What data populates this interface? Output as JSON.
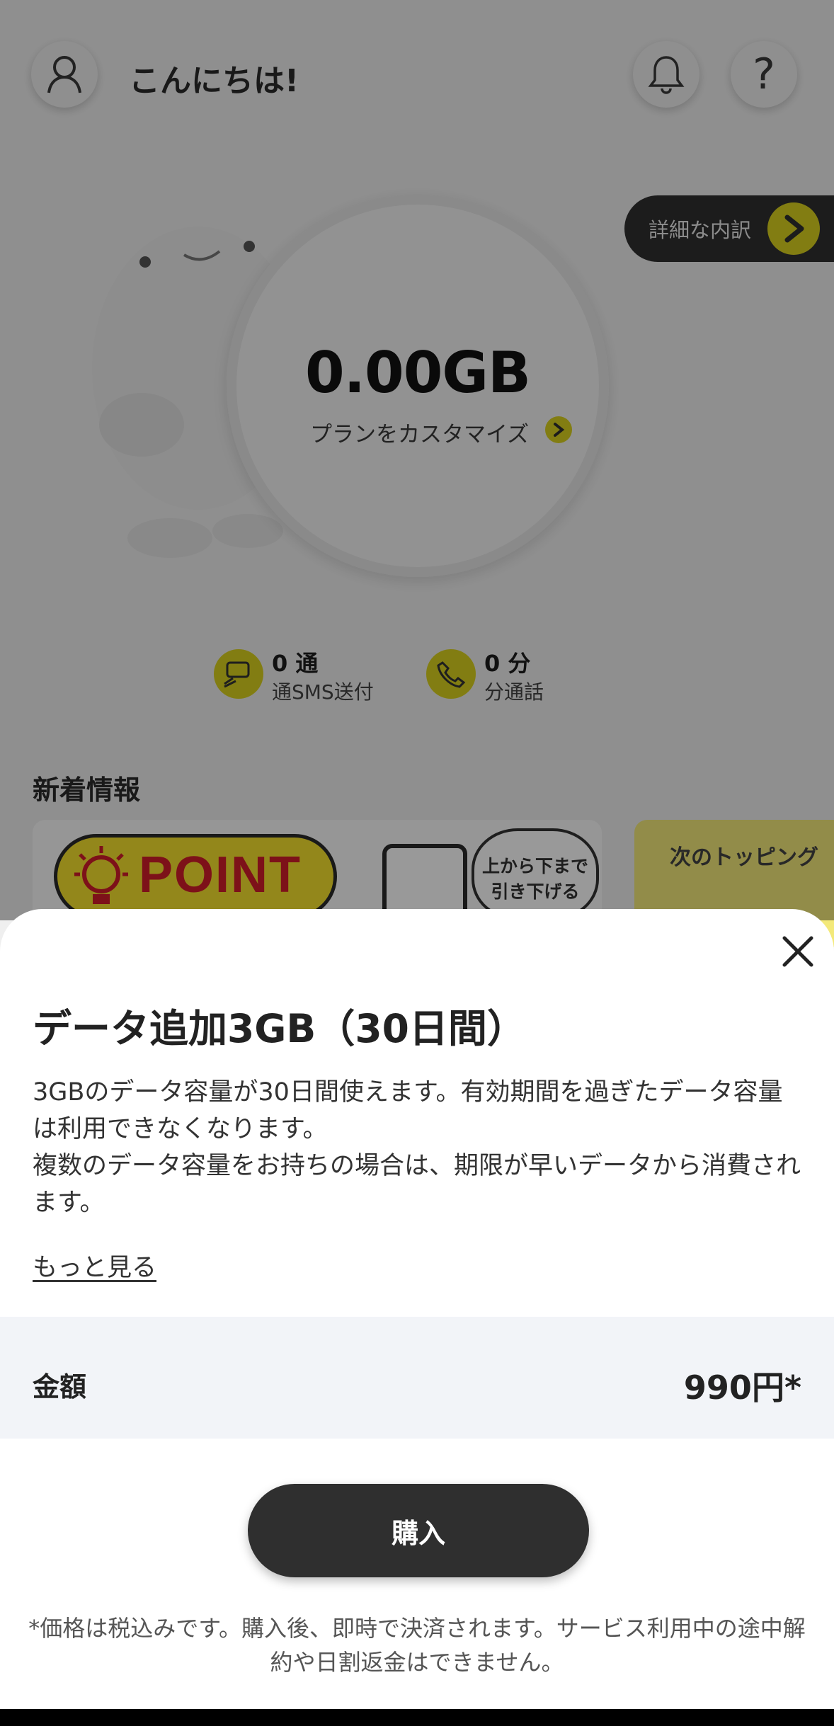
{
  "header": {
    "greeting": "こんにちは!",
    "avatar_icon": "user-icon",
    "notification_icon": "bell-icon",
    "help_label": "?"
  },
  "detail": {
    "label": "詳細な内訳",
    "arrow_icon": "chevron-right-icon"
  },
  "usage": {
    "data_value": "0.00GB",
    "customize_label": "プランをカスタマイズ"
  },
  "stats": {
    "sms_count": "0 通",
    "sms_label": "通SMS送付",
    "call_count": "0 分",
    "call_label": "分通話"
  },
  "news": {
    "title": "新着情報",
    "card1_point": "POINT",
    "card1_bubble_line1": "上から下まで",
    "card1_bubble_line2": "引き下げる",
    "card2_text": "次のトッピング"
  },
  "sheet": {
    "title": "データ追加3GB（30日間）",
    "desc_line1": "3GBのデータ容量が30日間使えます。有効期間を過ぎたデータ容量は利用できなくなります。",
    "desc_line2": "複数のデータ容量をお持ちの場合は、期限が早いデータから消費されます。",
    "more_link": "もっと見る",
    "price_label": "金額",
    "price_value": "990円*",
    "buy_label": "購入",
    "note": "*価格は税込みです。購入後、即時で決済されます。サービス利用中の途中解約や日割返金はできません。"
  },
  "colors": {
    "accent": "#d9d11f",
    "dark": "#2f2f2f",
    "sheet_bg": "#ffffff",
    "price_bg": "#f2f4f8"
  }
}
